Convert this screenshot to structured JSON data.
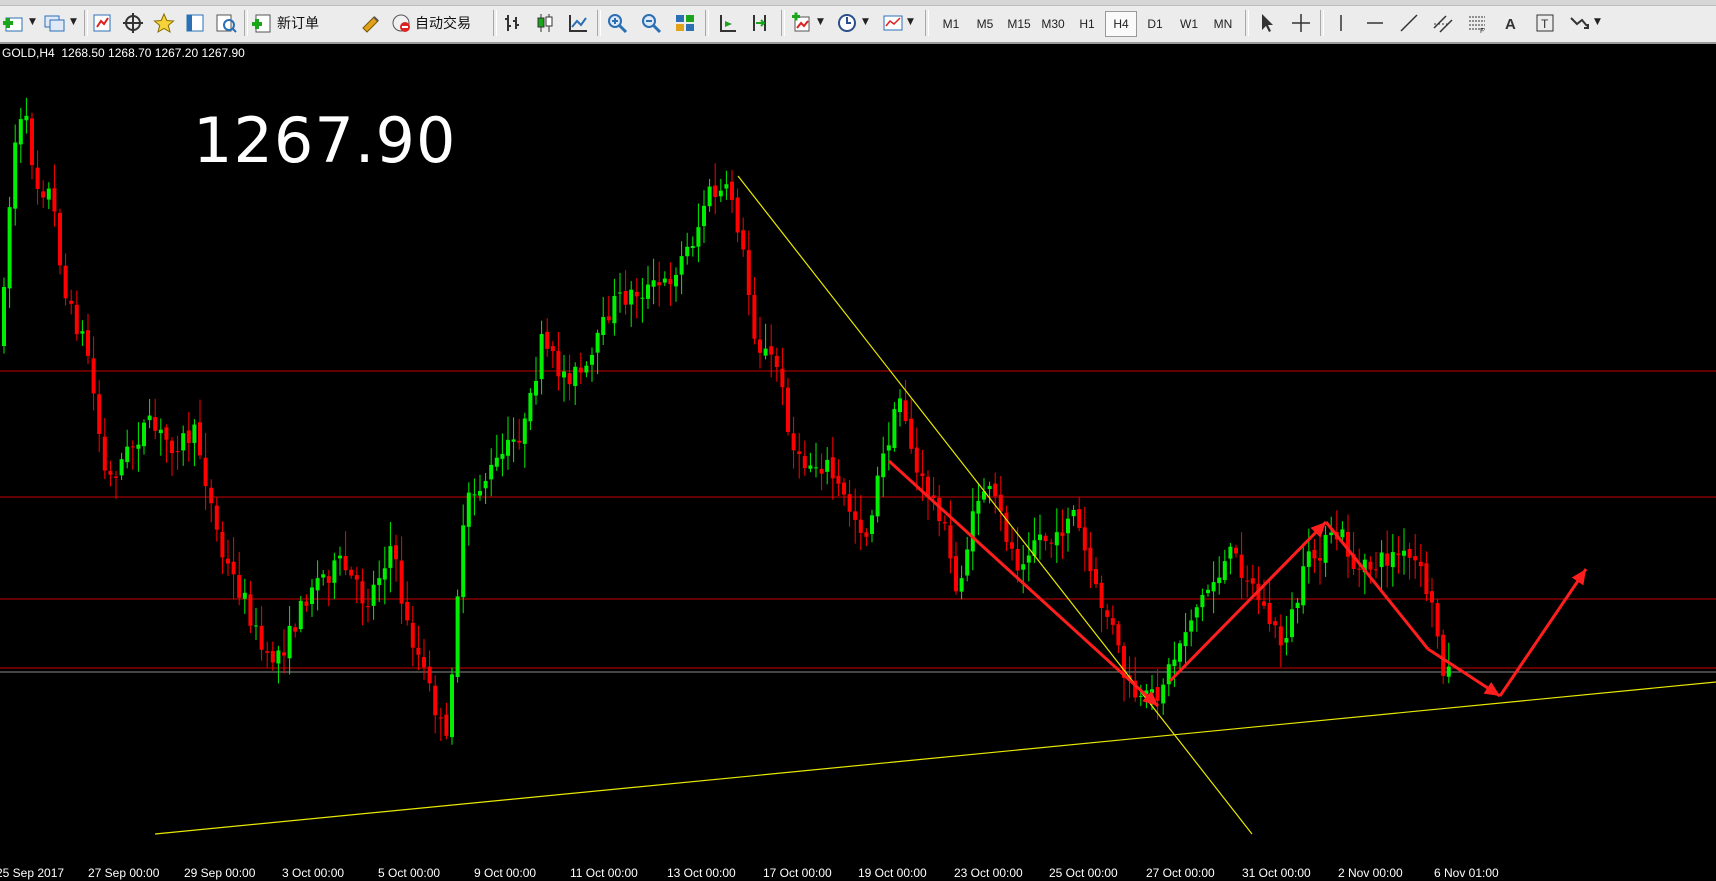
{
  "toolbar": {
    "new_order_label": "新订单",
    "auto_trade_label": "自动交易",
    "timeframes": [
      "M1",
      "M5",
      "M15",
      "M30",
      "H1",
      "H4",
      "D1",
      "W1",
      "MN"
    ],
    "active_timeframe": "H4",
    "icons": [
      "new-chart-icon",
      "profiles-icon",
      "market-watch-icon",
      "navigator-icon",
      "favorites-icon",
      "data-window-icon",
      "strategy-tester-icon",
      "new-order-icon",
      "metaeditor-icon",
      "auto-trading-icon",
      "bar-chart-icon",
      "candlestick-icon",
      "line-chart-icon",
      "zoom-in-icon",
      "zoom-out-icon",
      "tile-windows-icon",
      "autoscroll-icon",
      "chart-shift-icon",
      "indicators-icon",
      "periods-icon",
      "templates-icon",
      "cursor-icon",
      "crosshair-icon",
      "vertical-line-icon",
      "horizontal-line-icon",
      "trendline-icon",
      "equidistant-channel-icon",
      "fibonacci-icon",
      "text-icon",
      "text-label-icon",
      "arrows-icon"
    ]
  },
  "chart": {
    "symbol_info": "GOLD,H4  1268.50 1268.70 1267.20 1267.90",
    "big_price": "1267.90"
  },
  "chart_data": {
    "type": "candlestick",
    "symbol": "GOLD",
    "timeframe": "H4",
    "last_bar": {
      "open": 1268.5,
      "high": 1268.7,
      "low": 1267.2,
      "close": 1267.9
    },
    "x_tick_labels": [
      "25 Sep 2017",
      "27 Sep 00:00",
      "29 Sep 00:00",
      "3 Oct 00:00",
      "5 Oct 00:00",
      "9 Oct 00:00",
      "11 Oct 00:00",
      "13 Oct 00:00",
      "17 Oct 00:00",
      "19 Oct 00:00",
      "23 Oct 00:00",
      "25 Oct 00:00",
      "27 Oct 00:00",
      "31 Oct 00:00",
      "2 Nov 00:00",
      "6 Nov 01:00"
    ],
    "colors": {
      "bull": "#00ee00",
      "bear": "#ff0000",
      "background": "#000000",
      "trendline": "#e8e800",
      "level_line": "#c80000",
      "annotation": "#ff1e1e"
    }
  }
}
